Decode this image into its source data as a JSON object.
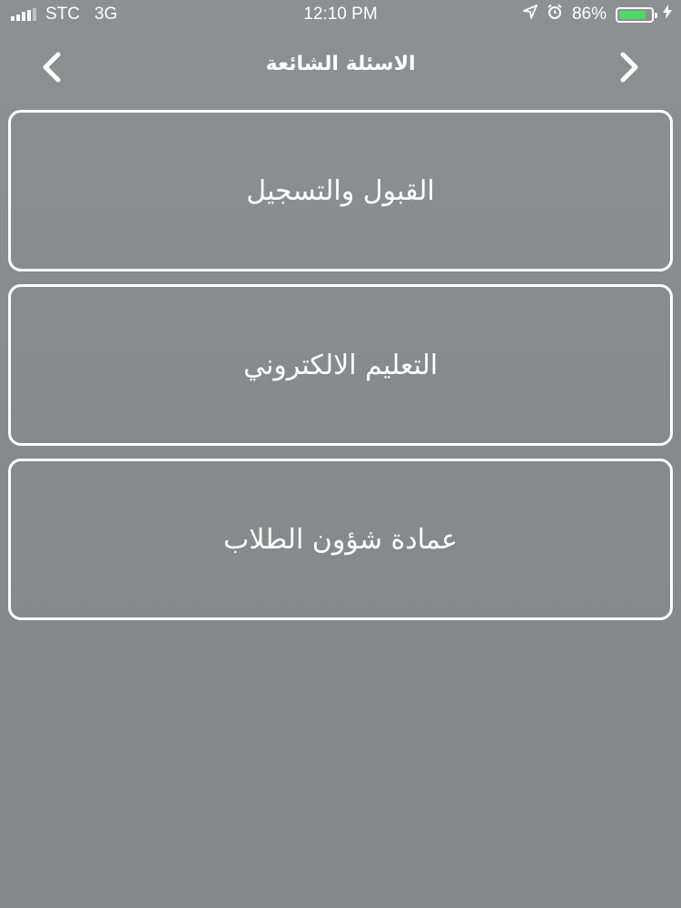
{
  "status_bar": {
    "carrier": "STC",
    "network": "3G",
    "time": "12:10 PM",
    "battery_percent": "86%",
    "battery_level": 0.86,
    "battery_color": "#4cd964",
    "icons": [
      "signal-icon",
      "location-arrow-icon",
      "alarm-clock-icon",
      "battery-icon",
      "charging-bolt-icon"
    ]
  },
  "nav": {
    "title": "الاسئلة الشائعة",
    "back_icon": "chevron-left-icon",
    "forward_icon": "chevron-right-icon"
  },
  "faq": {
    "items": [
      {
        "label": "القبول والتسجيل"
      },
      {
        "label": "التعليم الالكتروني"
      },
      {
        "label": "عمادة شؤون الطلاب"
      }
    ]
  }
}
